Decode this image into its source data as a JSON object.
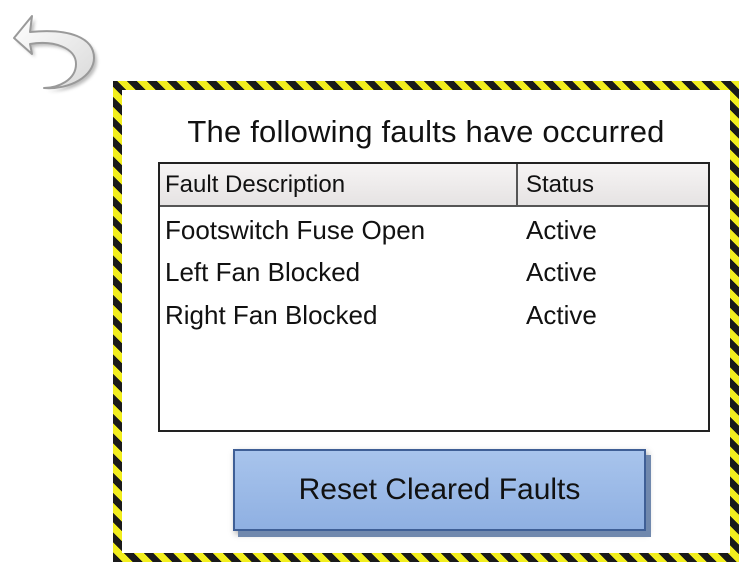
{
  "navigation": {
    "back_icon": "undo-arrow-icon"
  },
  "panel": {
    "title": "The following faults have occurred",
    "border_colors": [
      "#1a1a1a",
      "#f2ee1e"
    ]
  },
  "fault_table": {
    "columns": [
      "Fault Description",
      "Status"
    ],
    "rows": [
      {
        "description": "Footswitch Fuse Open",
        "status": "Active"
      },
      {
        "description": "Left Fan Blocked",
        "status": "Active"
      },
      {
        "description": "Right Fan Blocked",
        "status": "Active"
      }
    ]
  },
  "actions": {
    "reset_label": "Reset Cleared Faults",
    "reset_color": "#9bbbe8"
  }
}
